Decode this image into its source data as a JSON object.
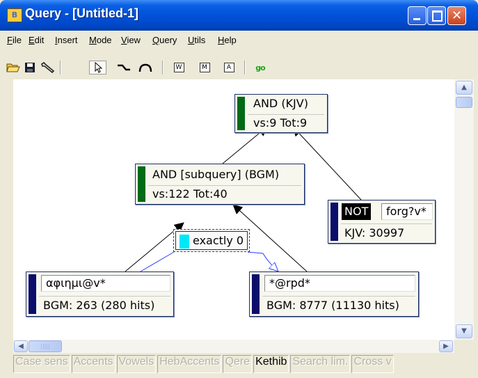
{
  "window": {
    "title": "Query - [Untitled-1]",
    "controls": {
      "minimize": "_",
      "maximize": "□",
      "close": "✕"
    }
  },
  "menu": {
    "items": [
      {
        "label": "File",
        "key": "F",
        "rest": "ile"
      },
      {
        "label": "Edit",
        "key": "E",
        "rest": "dit"
      },
      {
        "label": "Insert",
        "key": "I",
        "rest": "nsert"
      },
      {
        "label": "Mode",
        "key": "M",
        "rest": "ode"
      },
      {
        "label": "View",
        "key": "V",
        "rest": "iew"
      },
      {
        "label": "Query",
        "key": "Q",
        "rest": "uery"
      },
      {
        "label": "Utils",
        "key": "U",
        "rest": "tils"
      },
      {
        "label": "Help",
        "key": "H",
        "rest": "elp"
      }
    ]
  },
  "toolbar": {
    "buttons": [
      {
        "icon": "open-folder-icon"
      },
      {
        "icon": "save-disk-icon"
      },
      {
        "icon": "wrench-icon"
      },
      {
        "icon": "pointer-arrow-icon",
        "pressed": true
      },
      {
        "icon": "elbow-link-icon"
      },
      {
        "icon": "arc-link-icon"
      },
      {
        "icon": "word-box-icon",
        "label": "W"
      },
      {
        "icon": "morph-box-icon",
        "label": "M"
      },
      {
        "icon": "and-box-icon",
        "label": "A"
      },
      {
        "icon": "go-icon",
        "label": "go"
      }
    ]
  },
  "query": {
    "root": {
      "label": "AND (KJV)",
      "stats": "vs:9 Tot:9",
      "color": "#006b16"
    },
    "subquery": {
      "label": "AND [subquery] (BGM)",
      "stats": "vs:122 Tot:40",
      "color": "#006b16"
    },
    "not_node": {
      "badge": "NOT",
      "term": "forg?v*",
      "stats": "KJV: 30997",
      "color": "#0c0e6c"
    },
    "word_left": {
      "term": "αφιημι@v*",
      "stats": "BGM: 263 (280 hits)",
      "color": "#0c0e6c"
    },
    "word_right": {
      "term": "*@rpd*",
      "stats": "BGM: 8777 (11130 hits)",
      "color": "#0c0e6c"
    },
    "proximity": {
      "label": "exactly 0",
      "color": "#00e8f8"
    }
  },
  "scrollbars": {
    "up": "▲",
    "down": "▼",
    "left": "◀",
    "right": "▶",
    "grip": "|||||"
  },
  "status": {
    "items": [
      {
        "label": "Case sens",
        "active": false
      },
      {
        "label": "Accents",
        "active": false
      },
      {
        "label": "Vowels",
        "active": false
      },
      {
        "label": "HebAccents",
        "active": false
      },
      {
        "label": "Qere",
        "active": false
      },
      {
        "label": "Kethib",
        "active": true
      },
      {
        "label": "Search lim.",
        "active": false
      },
      {
        "label": "Cross v",
        "active": false
      }
    ]
  }
}
